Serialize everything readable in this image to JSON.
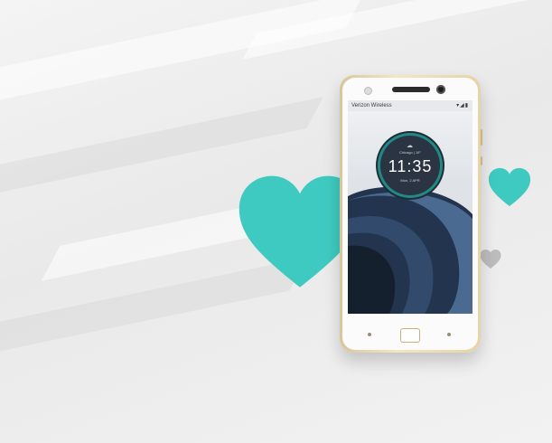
{
  "scene": {
    "background_color": "#eeeeee",
    "heart_color": "#3ecac0",
    "heart_small_gray_color": "#bcbcbc",
    "phone_trim_color": "#e5d1a4"
  },
  "phone": {
    "carrier": "Verizon Wireless",
    "status_icons": "▾◢▮",
    "clock": {
      "weather": "Chicago | 19°",
      "time": "11:35",
      "date": "Mon, 2 APR"
    }
  }
}
